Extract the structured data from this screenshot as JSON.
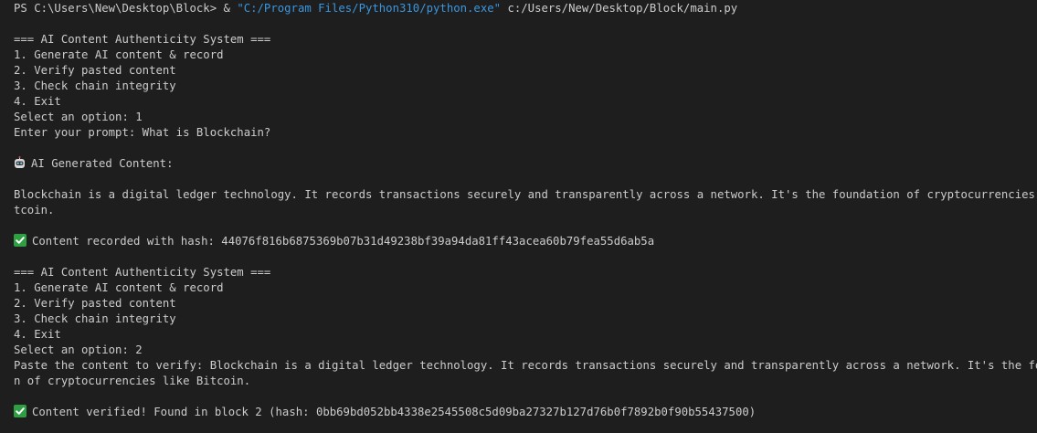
{
  "terminal": {
    "prompt_prefix": "PS C:\\Users\\New\\Desktop\\Block> & ",
    "python_path": "\"C:/Program Files/Python310/python.exe\"",
    "script_path": " c:/Users/New/Desktop/Block/main.py",
    "menu1": {
      "title": "=== AI Content Authenticity System ===",
      "options": [
        "1. Generate AI content & record",
        "2. Verify pasted content",
        "3. Check chain integrity",
        "4. Exit"
      ],
      "select": "Select an option: 1"
    },
    "prompt_input": "Enter your prompt: What is Blockchain?",
    "ai_header": "AI Generated Content:",
    "ai_content_line1": "Blockchain is a digital ledger technology. It records transactions securely and transparently across a network. It's the foundation of cryptocurrencies like Bi",
    "ai_content_line2": "tcoin.",
    "recorded_msg": "Content recorded with hash: 44076f816b6875369b07b31d49238bf39a94da81ff43acea60b79fea55d6ab5a",
    "menu2": {
      "title": "=== AI Content Authenticity System ===",
      "options": [
        "1. Generate AI content & record",
        "2. Verify pasted content",
        "3. Check chain integrity",
        "4. Exit"
      ],
      "select": "Select an option: 2"
    },
    "paste_line1": "Paste the content to verify: Blockchain is a digital ledger technology. It records transactions securely and transparently across a network. It's the foundatio",
    "paste_line2": "n of cryptocurrencies like Bitcoin.",
    "verified_msg": "Content verified! Found in block 2 (hash: 0bb69bd052bb4338e2545508c5d09ba27327b127d76b0f7892b0f90b55437500)"
  }
}
